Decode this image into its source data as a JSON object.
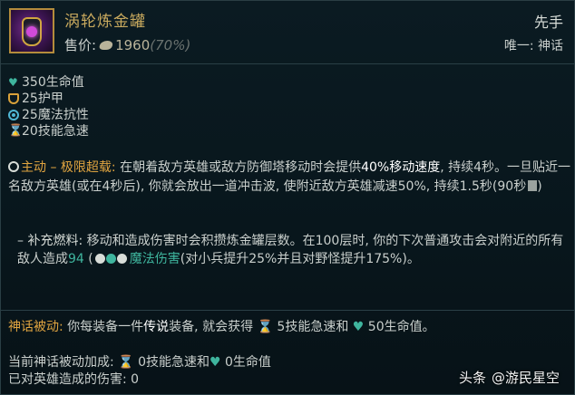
{
  "item": {
    "name": "涡轮炼金罐",
    "price_label": "售价:",
    "price": "1960",
    "price_pct": "(70%)",
    "slot": "先手",
    "unique": "唯一: 神话"
  },
  "stats": [
    {
      "icon": "heart-icon",
      "text": "350生命值"
    },
    {
      "icon": "armor-icon",
      "text": "25护甲"
    },
    {
      "icon": "magic-resist-icon",
      "text": "25魔法抗性"
    },
    {
      "icon": "ability-haste-icon",
      "text": "20技能急速"
    }
  ],
  "active": {
    "name": "主动 – 极限超载:",
    "text_1": " 在朝着敌方英雄或敌方防御塔移动时会提供",
    "kw": "40%移动速度",
    "text_2": ", 持续4秒。一旦贴近一名敌方英雄(或在4秒后), 你就会放出一道冲击波, 使附近敌方英雄减速50%, 持续1.5秒(90秒",
    "text_3": ")"
  },
  "sub_passive": {
    "prefix": "–",
    "name": "补充燃料:",
    "text_1": " 移动和造成伤害时会积攒炼金罐层数。在100层时, 你的下次普通攻击会对附近的所有敌人造成",
    "damage": "94",
    "paren_open": " (",
    "magic": "魔法伤害",
    "text_2": "(对小兵提升25%并且对野怪提升175%)。"
  },
  "mythic": {
    "name": "神话被动:",
    "text_1": " 你每装备一件",
    "kw": "传说",
    "text_2": "装备, 就会获得 ",
    "haste": "5技能急速和",
    "hp": "50生命值。"
  },
  "current": {
    "line1_label": "当前神话被动加成: ",
    "line1_haste": "0技能急速和",
    "line1_hp": " 0生命值",
    "line2": "已对英雄造成的伤害: 0"
  },
  "watermark": {
    "brand": "头条",
    "handle": "@游民星空"
  },
  "colors": {
    "gold_title": "#c8a95e",
    "active_orange": "#e0a440",
    "health_teal": "#3fb59e"
  }
}
